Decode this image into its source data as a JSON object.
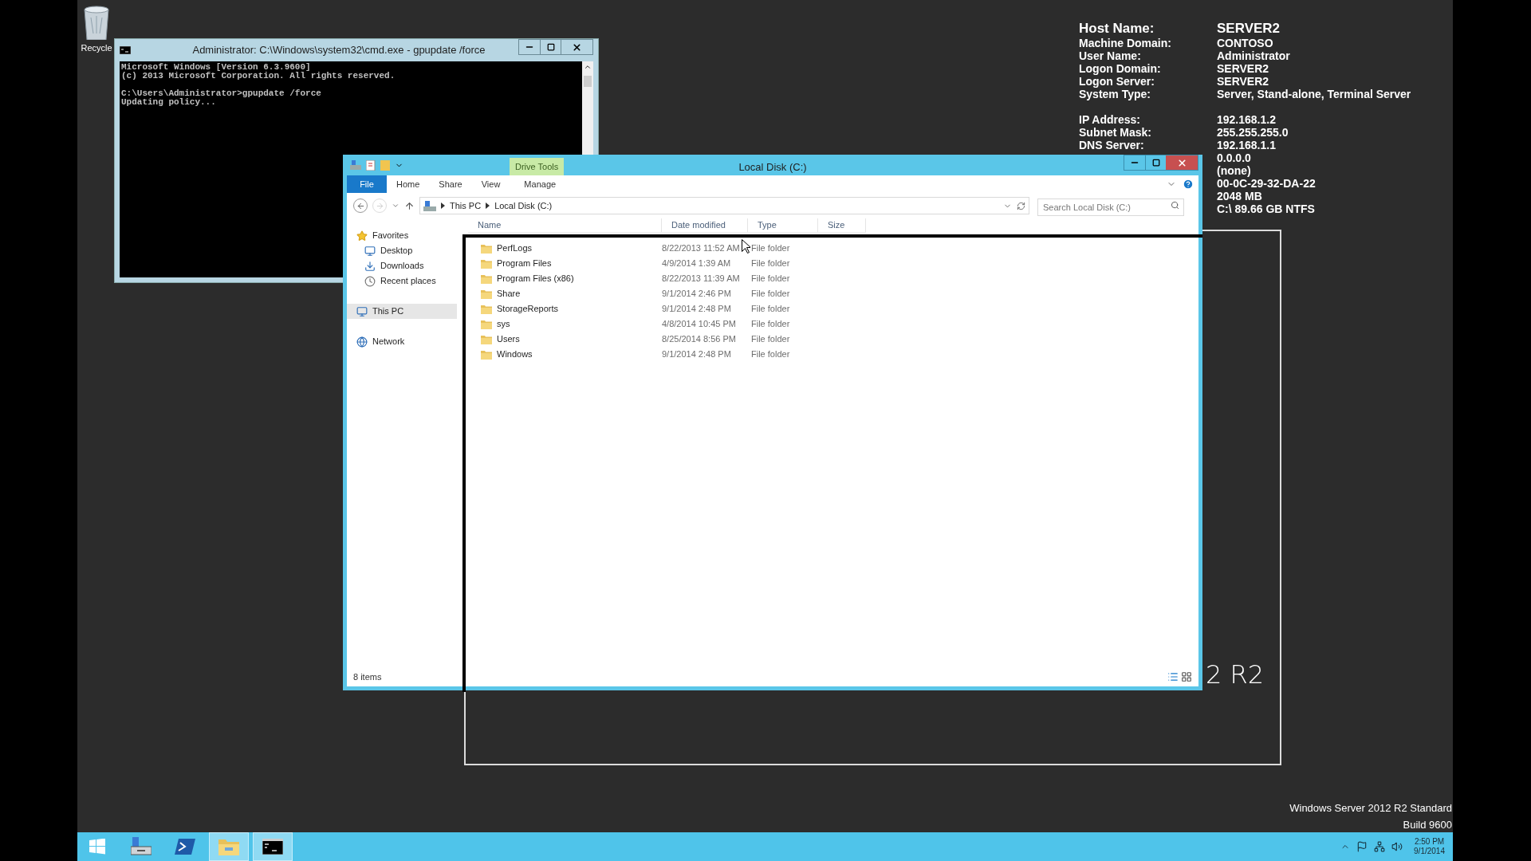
{
  "desktop": {
    "icons": [
      {
        "label": "Recycle"
      }
    ],
    "wallpaper_text": "2 R2",
    "edition": "Windows Server 2012 R2 Standard",
    "build": "Build 9600"
  },
  "bginfo": {
    "groups": [
      [
        {
          "label": "Host Name:",
          "value": "SERVER2",
          "kind": "host"
        },
        {
          "label": "Machine Domain:",
          "value": "CONTOSO",
          "kind": "plain"
        },
        {
          "label": "User Name:",
          "value": "Administrator",
          "kind": "plain"
        },
        {
          "label": "Logon Domain:",
          "value": "SERVER2",
          "kind": "plain"
        },
        {
          "label": "Logon Server:",
          "value": "SERVER2",
          "kind": "plain"
        },
        {
          "label": "System Type:",
          "value": "Server, Stand-alone, Terminal Server",
          "kind": "plain"
        }
      ],
      [
        {
          "label": "IP Address:",
          "value": "192.168.1.2",
          "kind": "plain"
        },
        {
          "label": "Subnet Mask:",
          "value": "255.255.255.0",
          "kind": "plain"
        },
        {
          "label": "DNS Server:",
          "value": "192.168.1.1",
          "kind": "plain"
        },
        {
          "value": "0.0.0.0",
          "kind": "plain"
        },
        {
          "value": "(none)",
          "kind": "plain"
        },
        {
          "value": "00-0C-29-32-DA-22",
          "kind": "plain"
        },
        {
          "value": "2048 MB",
          "kind": "plain"
        },
        {
          "value": "C:\\ 89.66 GB NTFS",
          "kind": "plain"
        }
      ]
    ]
  },
  "cmd": {
    "title": "Administrator: C:\\Windows\\system32\\cmd.exe - gpupdate  /force",
    "blocks": [
      [
        "Microsoft Windows [Version 6.3.9600]",
        "(c) 2013 Microsoft Corporation. All rights reserved."
      ],
      [
        "C:\\Users\\Administrator>gpupdate /force",
        "Updating policy..."
      ]
    ]
  },
  "explorer": {
    "title": "Local Disk (C:)",
    "contextual_group": "Drive Tools",
    "ribbon_tabs": [
      {
        "label": "File",
        "kind": "file"
      },
      {
        "label": "Home",
        "kind": "tab"
      },
      {
        "label": "Share",
        "kind": "tab"
      },
      {
        "label": "View",
        "kind": "tab"
      },
      {
        "label": "Manage",
        "kind": "contextual"
      }
    ],
    "breadcrumb": [
      "This PC",
      "Local Disk (C:)"
    ],
    "search": {
      "placeholder": "Search Local Disk (C:)"
    },
    "nav": [
      {
        "label": "Favorites",
        "kind": "favorites",
        "selected": false,
        "children": [
          {
            "label": "Desktop",
            "kind": "desktop",
            "selected": false
          },
          {
            "label": "Downloads",
            "kind": "downloads",
            "selected": false
          },
          {
            "label": "Recent places",
            "kind": "recent",
            "selected": false
          }
        ]
      },
      {
        "label": "This PC",
        "kind": "pc",
        "selected": true
      },
      {
        "label": "Network",
        "kind": "network",
        "selected": false
      }
    ],
    "columns": [
      "Name",
      "Date modified",
      "Type",
      "Size"
    ],
    "rows": [
      {
        "name": "PerfLogs",
        "date": "8/22/2013 11:52 AM",
        "type": "File folder"
      },
      {
        "name": "Program Files",
        "date": "4/9/2014 1:39 AM",
        "type": "File folder"
      },
      {
        "name": "Program Files (x86)",
        "date": "8/22/2013 11:39 AM",
        "type": "File folder"
      },
      {
        "name": "Share",
        "date": "9/1/2014 2:46 PM",
        "type": "File folder"
      },
      {
        "name": "StorageReports",
        "date": "9/1/2014 2:48 PM",
        "type": "File folder"
      },
      {
        "name": "sys",
        "date": "4/8/2014 10:45 PM",
        "type": "File folder"
      },
      {
        "name": "Users",
        "date": "8/25/2014 8:56 PM",
        "type": "File folder"
      },
      {
        "name": "Windows",
        "date": "9/1/2014 2:48 PM",
        "type": "File folder"
      }
    ],
    "status": "8 items"
  },
  "taskbar": {
    "apps": [
      {
        "kind": "start",
        "running": false
      },
      {
        "kind": "server-manager",
        "running": false
      },
      {
        "kind": "powershell",
        "running": false
      },
      {
        "kind": "explorer",
        "running": true
      },
      {
        "kind": "cmd",
        "running": true
      }
    ],
    "clock": {
      "time": "2:50 PM",
      "date": "9/1/2014"
    }
  }
}
